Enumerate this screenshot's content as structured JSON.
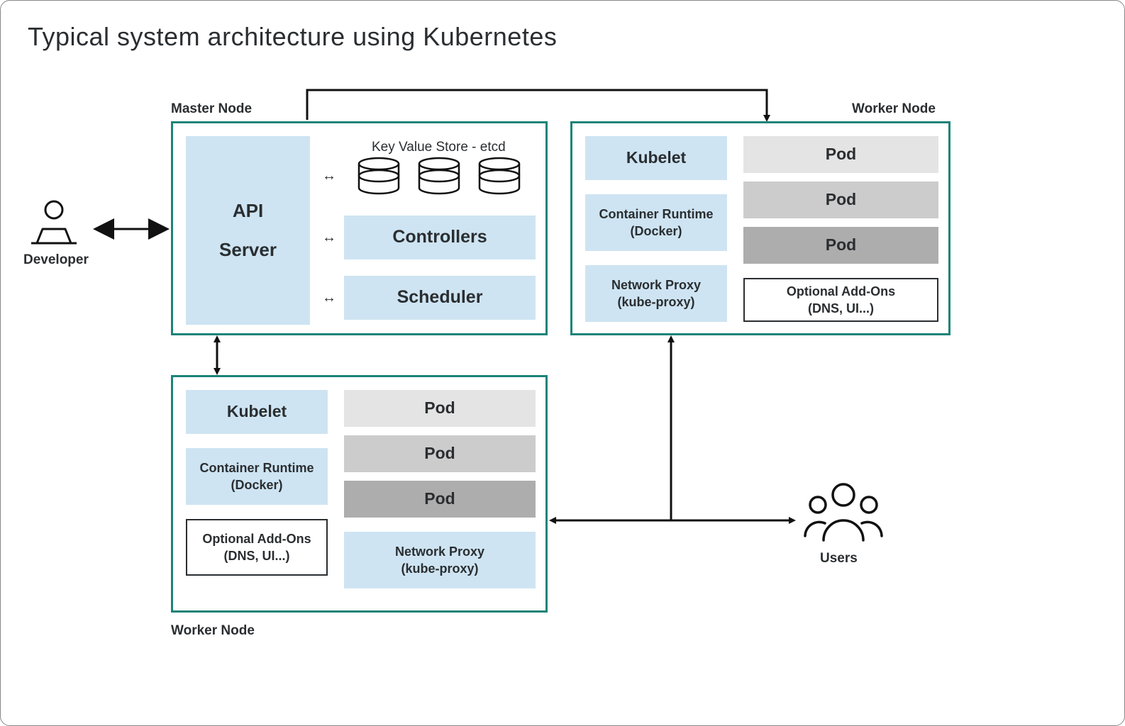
{
  "title": "Typical system architecture using Kubernetes",
  "actors": {
    "developer": "Developer",
    "users": "Users"
  },
  "master": {
    "label": "Master Node",
    "api_server_l1": "API",
    "api_server_l2": "Server",
    "etcd_label": "Key Value Store - etcd",
    "controllers": "Controllers",
    "scheduler": "Scheduler"
  },
  "worker": {
    "label": "Worker Node",
    "kubelet": "Kubelet",
    "container_runtime_l1": "Container Runtime",
    "container_runtime_l2": "(Docker)",
    "network_proxy_l1": "Network Proxy",
    "network_proxy_l2": "(kube-proxy)",
    "addons_l1": "Optional Add-Ons",
    "addons_l2": "(DNS, UI...)",
    "pod": "Pod"
  }
}
